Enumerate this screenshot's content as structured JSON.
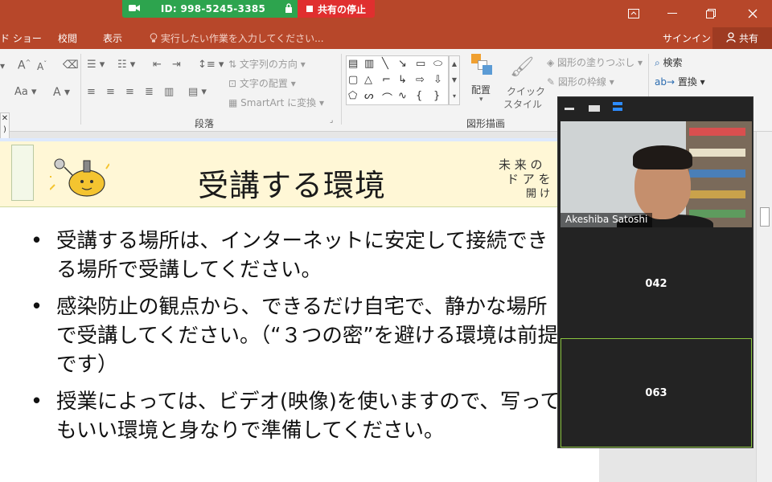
{
  "zoom": {
    "meeting_id": "ID: 998-5245-3385",
    "stop_share_label": "共有の停止",
    "share_color": "#2da44e",
    "stop_color": "#e02f2f"
  },
  "window": {
    "tabs": [
      "ド ショー",
      "校閲",
      "表示"
    ],
    "tell_me": "実行したい作業を入力してください...",
    "sign_in": "サインイン",
    "share": "共有",
    "accent": "#b7472a"
  },
  "ribbon": {
    "paragraph_group": "段落",
    "drawing_group": "図形描画",
    "text_direction": "文字列の方向",
    "align_text": "文字の配置",
    "smartart": "SmartArt に変換",
    "arrange": "配置",
    "quick_style_1": "クイック",
    "quick_style_2": "スタイル",
    "shape_fill": "図形の塗りつぶし",
    "shape_outline": "図形の枠線",
    "find": "検索",
    "replace": "置換"
  },
  "slide": {
    "title": "受講する環境",
    "tagline_1": "未 来 の",
    "tagline_2": "ド ア を",
    "tagline_3": "開 け",
    "bullets": [
      "受講する場所は、インターネットに安定して接続できる場所で受講してください。",
      "感染防止の観点から、できるだけ自宅で、静かな場所で受講してください。（“３つの密”を避ける環境は前提です）",
      "授業によっては、ビデオ(映像)を使いますので、写ってもいい環境と身なりで準備してください。"
    ]
  },
  "participants": {
    "speaker_name": "Akeshiba Satoshi",
    "tile_1": "042",
    "tile_2": "063",
    "active_color": "#8ac43f"
  }
}
